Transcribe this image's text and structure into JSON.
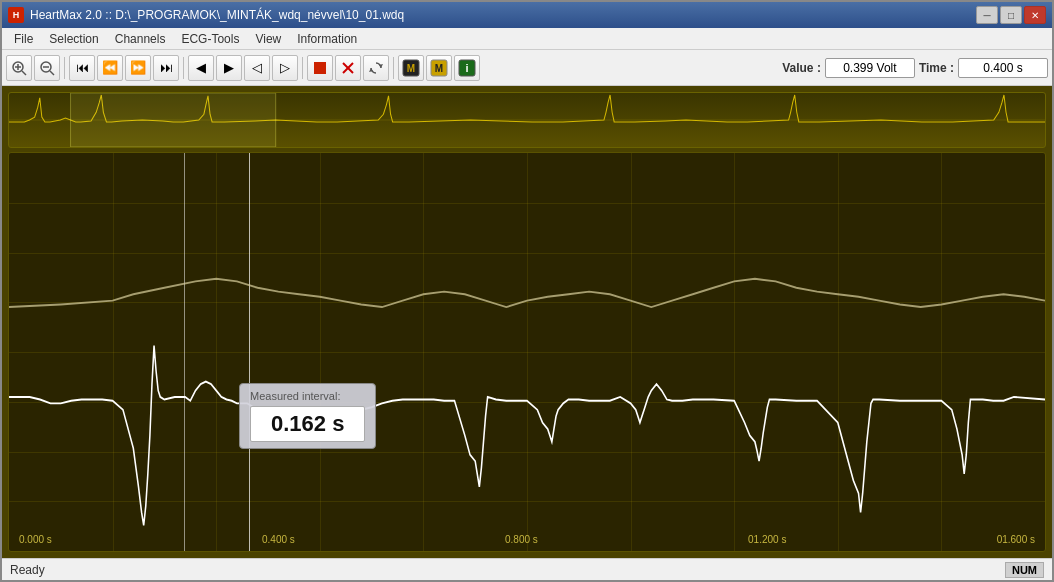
{
  "window": {
    "title": "HeartMax 2.0 :: D:\\_PROGRAMOK\\_MINTÁK_wdq_névvel\\10_01.wdq",
    "app_icon": "H",
    "controls": {
      "minimize": "─",
      "maximize": "□",
      "close": "✕"
    }
  },
  "menu": {
    "items": [
      "File",
      "Selection",
      "Channels",
      "ECG-Tools",
      "View",
      "Information"
    ]
  },
  "toolbar": {
    "buttons": [
      {
        "name": "zoom-in",
        "icon": "🔍",
        "label": "zoom-in"
      },
      {
        "name": "zoom-out",
        "icon": "🔍",
        "label": "zoom-out"
      },
      {
        "name": "go-start",
        "icon": "⏮",
        "label": "go-start"
      },
      {
        "name": "go-prev",
        "icon": "⏪",
        "label": "go-prev"
      },
      {
        "name": "go-next",
        "icon": "⏩",
        "label": "go-next"
      },
      {
        "name": "go-end",
        "icon": "⏭",
        "label": "go-end"
      },
      {
        "name": "scroll-left",
        "icon": "◀",
        "label": "scroll-left"
      },
      {
        "name": "scroll-right",
        "icon": "▶",
        "label": "scroll-right"
      },
      {
        "name": "pan-left",
        "icon": "◁",
        "label": "pan-left"
      },
      {
        "name": "pan-right",
        "icon": "▷",
        "label": "pan-right"
      },
      {
        "name": "stop",
        "icon": "■",
        "label": "stop"
      },
      {
        "name": "delete",
        "icon": "✕",
        "label": "delete"
      },
      {
        "name": "refresh",
        "icon": "↺",
        "label": "refresh"
      },
      {
        "name": "mark1",
        "icon": "⬛",
        "label": "mark1"
      },
      {
        "name": "mark2",
        "icon": "⬛",
        "label": "mark2"
      },
      {
        "name": "info",
        "icon": "ℹ",
        "label": "info"
      }
    ]
  },
  "value_display": {
    "value_label": "Value :",
    "value": "0.399  Volt",
    "time_label": "Time :",
    "time": "0.400 s"
  },
  "ecg": {
    "time_labels": [
      "0.000  s",
      "0.400  s",
      "0.800  s",
      "01.200  s",
      "01.600  s"
    ]
  },
  "measure_popup": {
    "title": "Measured interval:",
    "value": "0.162 s"
  },
  "status": {
    "ready": "Ready",
    "num": "NUM"
  }
}
